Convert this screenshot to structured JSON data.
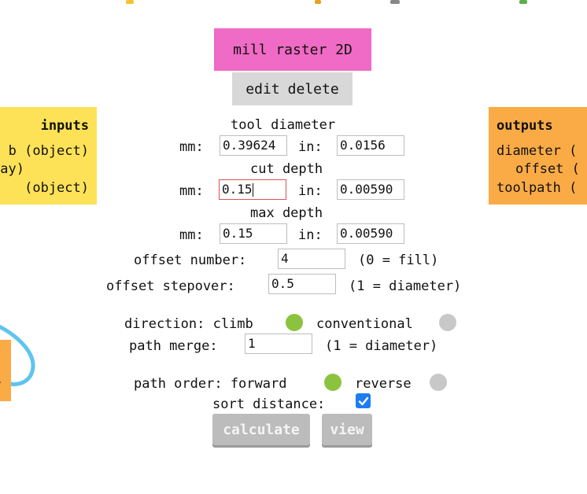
{
  "module": {
    "title": "mill raster 2D",
    "edit_label": "edit",
    "delete_label": "delete"
  },
  "inputs_panel": {
    "header": "inputs",
    "lines": [
      "b (object)",
      "ray)",
      "(object)"
    ]
  },
  "outputs_panel": {
    "header": "outputs",
    "lines": [
      "diameter (",
      "offset (",
      "toolpath ("
    ]
  },
  "tool_diameter": {
    "label": "tool diameter",
    "mm_label": "mm:",
    "mm_value": "0.39624",
    "in_label": "in:",
    "in_value": "0.0156"
  },
  "cut_depth": {
    "label": "cut depth",
    "mm_label": "mm:",
    "mm_value": "0.15",
    "in_label": "in:",
    "in_value": "0.00590"
  },
  "max_depth": {
    "label": "max depth",
    "mm_label": "mm:",
    "mm_value": "0.15",
    "in_label": "in:",
    "in_value": "0.00590"
  },
  "offset_number": {
    "label": "offset number:",
    "value": "4",
    "hint": "(0 = fill)"
  },
  "offset_stepover": {
    "label": "offset stepover:",
    "value": "0.5",
    "hint": "(1 = diameter)"
  },
  "direction": {
    "label": "direction: climb",
    "option2": "conventional",
    "selected": "climb"
  },
  "path_merge": {
    "label": "path merge:",
    "value": "1",
    "hint": "(1 = diameter)"
  },
  "path_order": {
    "label": "path order: forward",
    "option2": "reverse",
    "selected": "forward"
  },
  "sort_distance": {
    "label": "sort distance:",
    "checked": true
  },
  "buttons": {
    "calculate": "calculate",
    "view": "view"
  },
  "left_node_text": ">",
  "colors": {
    "title_bg": "#f06bc5",
    "inputs_bg": "#fde257",
    "outputs_bg": "#fbab46",
    "radio_on": "#8cc33e",
    "radio_off": "#c8c8c8",
    "checkbox": "#1c7cf0",
    "wire": "#5ec5ee"
  }
}
